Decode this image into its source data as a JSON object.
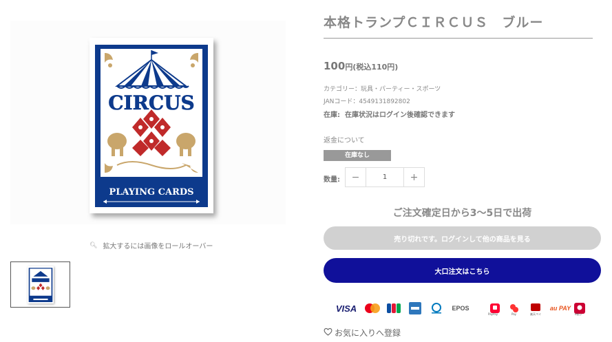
{
  "product": {
    "title": "本格トランプＣＩＲＣＵＳ　ブルー",
    "price_num": "100",
    "price_unit": "円(税込110円)",
    "category": "カテゴリー：玩具・パーティー・スポーツ",
    "jan": "JANコード：4549131892802",
    "stock_label": "在庫:",
    "stock_text": "在庫状況はログイン後確認できます",
    "refund": "返金について",
    "badge": "在庫なし",
    "qty_label": "数量:",
    "qty_value": "1",
    "qty_minus": "−",
    "qty_plus": "+",
    "shipping": "ご注文確定日から3〜5日で出荷",
    "soldout_button": "売り切れです。ログインして他の商品を見る",
    "bulk_button": "大口注文はこちら",
    "favorite": "お気に入りへ登録"
  },
  "gallery": {
    "zoom_hint": "拡大するには画像をロールオーバー",
    "card_title": "CIRCUS",
    "card_subtitle": "PLAYING CARDS"
  },
  "payments": {
    "visa": "VISA",
    "epos": "EPOS",
    "paypay_caption": "PayPay",
    "merpay_caption": "Pay",
    "rakuten_caption": "楽天ペイ",
    "aupay": "au PAY",
    "dbarai_caption": "d払い"
  },
  "colors": {
    "card_blue": "#0d3a8c",
    "card_gold": "#c9a66b",
    "card_red": "#c02a2a",
    "bulk_button": "#10109a",
    "soldout_button": "#d1d1d1",
    "badge": "#999999"
  },
  "icons": {
    "zoom": "search-icon",
    "favorite": "heart-icon",
    "quantity_decrease": "minus-icon",
    "quantity_increase": "plus-icon"
  }
}
